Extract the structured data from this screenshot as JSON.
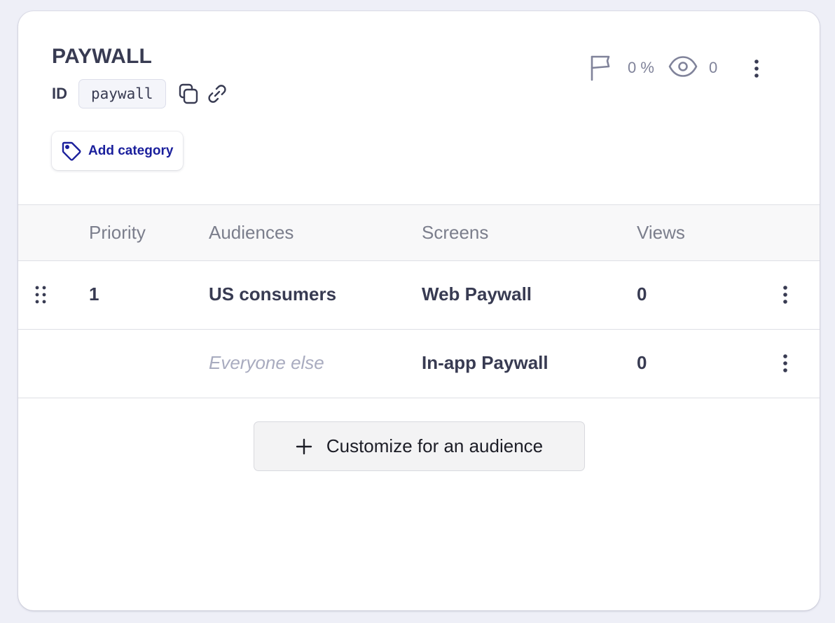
{
  "paywall": {
    "title": "PAYWALL",
    "id_label": "ID",
    "id_value": "paywall",
    "add_category_label": "Add category",
    "stats": {
      "percent": "0 %",
      "views": "0"
    }
  },
  "table": {
    "columns": [
      "Priority",
      "Audiences",
      "Screens",
      "Views"
    ],
    "rows": [
      {
        "priority": "1",
        "audience": "US consumers",
        "screen": "Web Paywall",
        "views": "0"
      },
      {
        "priority": "",
        "audience": "Everyone else",
        "screen": "In-app Paywall",
        "views": "0"
      }
    ]
  },
  "customize_label": "Customize for an audience",
  "colors": {
    "background": "#eeeff7",
    "card": "#ffffff",
    "accent": "#1a1f9c",
    "text": "#383b52",
    "muted": "#a8abbf"
  },
  "icons": [
    "copy-icon",
    "link-icon",
    "tag-icon",
    "flag-icon",
    "eye-icon",
    "kebab-menu-icon",
    "drag-handle-icon",
    "plus-icon"
  ]
}
